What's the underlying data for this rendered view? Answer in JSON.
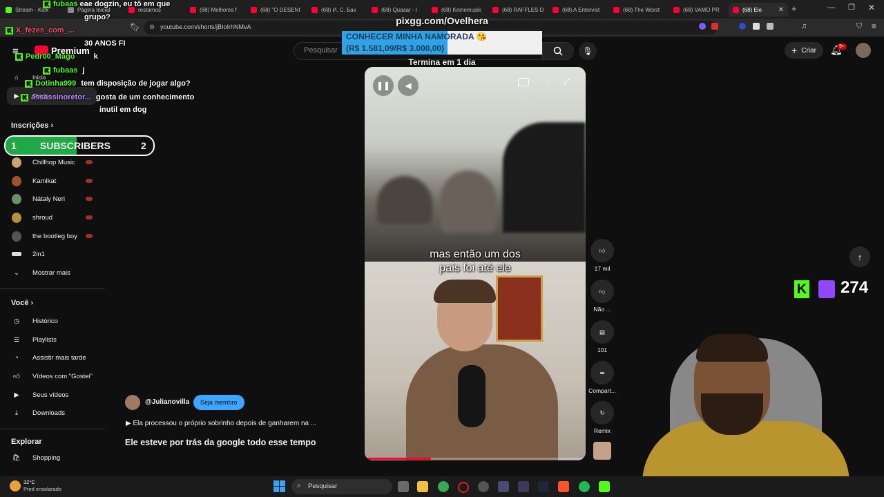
{
  "browser": {
    "tabs": [
      {
        "label": "Stream - Kick",
        "x": 0
      },
      {
        "label": "Página Inicial",
        "x": 0
      },
      {
        "label": "restamos",
        "x": 0
      },
      {
        "label": "(68) Melhores f",
        "x": 0
      },
      {
        "label": "(68) \"O DESENI",
        "x": 0
      },
      {
        "label": "(68) И. С. Бах",
        "x": 0
      },
      {
        "label": "(68) Quasar - I",
        "x": 0
      },
      {
        "label": "(68) Keinemusik",
        "x": 0
      },
      {
        "label": "(68) RAFFLES D",
        "x": 0
      },
      {
        "label": "(68) A Entrevist",
        "x": 0
      },
      {
        "label": "(68) The Worst",
        "x": 0
      },
      {
        "label": "(68) VAMO PR",
        "x": 0
      },
      {
        "label": "(68) Ele",
        "x": 0
      }
    ],
    "url": "youtube.com/shorts/jBIoIrhNMvA"
  },
  "youtube": {
    "search_placeholder": "Pesquisar",
    "premium_label": "Premium",
    "create_label": "Criar",
    "notif_badge": "9+",
    "sidebar": {
      "top": [
        {
          "label": "Início"
        },
        {
          "label": "Shorts"
        }
      ],
      "subs_heading": "Inscrições",
      "subs": [
        {
          "label": "Chillhop Music"
        },
        {
          "label": "Kamikat"
        },
        {
          "label": "Nátaly Neri"
        },
        {
          "label": "shroud"
        },
        {
          "label": "the bootleg boy"
        },
        {
          "label": "2in1"
        }
      ],
      "show_more": "Mostrar mais",
      "you_heading": "Você",
      "you_items": [
        {
          "label": "Histórico"
        },
        {
          "label": "Playlists"
        },
        {
          "label": "Assistir mais tarde"
        },
        {
          "label": "Vídeos com \"Gostei\""
        },
        {
          "label": "Seus vídeos"
        },
        {
          "label": "Downloads"
        }
      ],
      "explore_heading": "Explorar",
      "explore_items": [
        {
          "label": "Shopping"
        }
      ]
    },
    "short": {
      "caption": "mas então um dos\npais foi até ele",
      "channel": "@Julianovilla",
      "member_button": "Seja membro",
      "description": "▶ Ela processou o próprio sobrinho depois de ganharem na ...",
      "title": "Ele esteve por trás da google todo esse tempo",
      "likes": "17 mil",
      "dislike_label": "Não ...",
      "comments": "101",
      "share_label": "Compart...",
      "remix_label": "Remix"
    }
  },
  "overlay": {
    "pix_url": "pixgg.com/Ovelhera",
    "goal_title": "CONHECER MINHA NAMORADA 😘",
    "goal_amount": "(R$ 1.581,09/R$ 3.000,00)",
    "goal_progress": 0.527,
    "goal_ends": "Termina em 1 dia",
    "subscribers_label": "SUBSCRIBERS",
    "subs_left": "1",
    "subs_right": "2",
    "viewer_count": "274",
    "chat": [
      {
        "user": "fubaas",
        "text": "eae dogzin, eu tô em que"
      },
      {
        "user": "",
        "text": "grupo?"
      },
      {
        "user": "X_fezes_com_...",
        "text": ""
      },
      {
        "user": "",
        "text": "30 ANOS FI"
      },
      {
        "user": "Pedr00_Mago",
        "text": "k"
      },
      {
        "user": "fubaas",
        "text": "j"
      },
      {
        "user": "Dotinha999",
        "text": "tem disposição de jogar algo?"
      },
      {
        "user": "assassinoretor...",
        "text": "gosta de um conhecimento"
      },
      {
        "user": "",
        "text": "inutil em dog"
      }
    ]
  },
  "taskbar": {
    "weather_temp": "32°C",
    "weather_desc": "Pred ensolarado",
    "search_label": "Pesquisar"
  }
}
